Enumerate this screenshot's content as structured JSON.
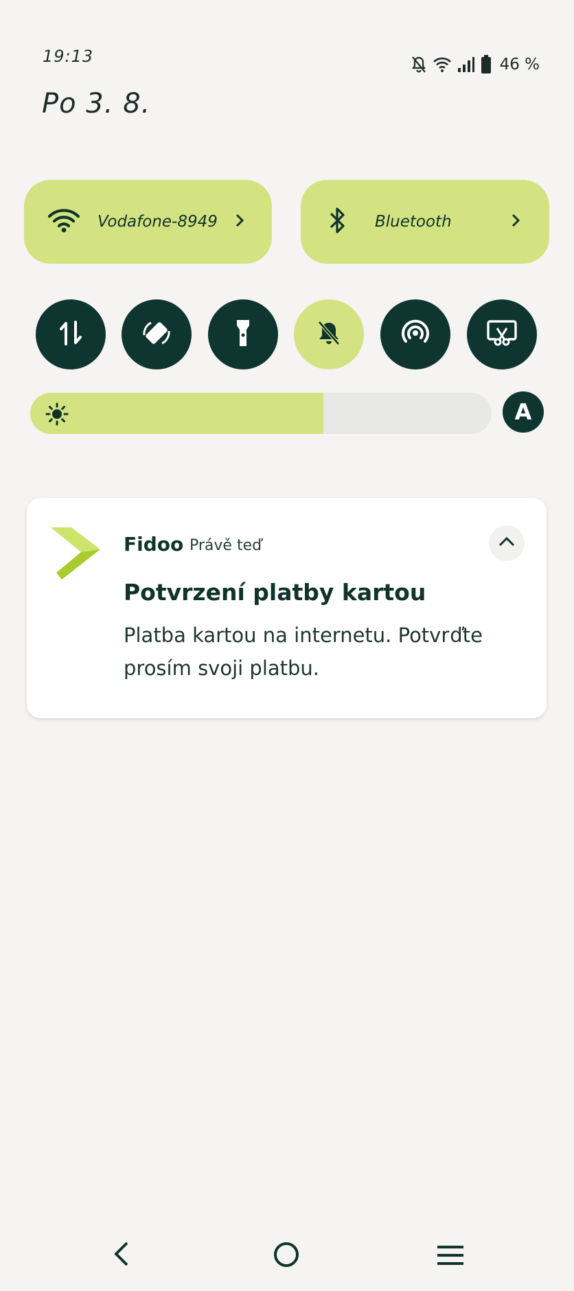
{
  "status_bar": {
    "time": "19:13",
    "battery_percent": "46 %",
    "icons": [
      "bell-off-icon",
      "wifi-icon",
      "signal-icon",
      "battery-icon"
    ]
  },
  "date": "Po 3. 8.",
  "tiles": {
    "wifi": {
      "label": "Vodafone-8949",
      "icon": "wifi-icon"
    },
    "bluetooth": {
      "label": "Bluetooth",
      "icon": "bluetooth-icon"
    }
  },
  "quick_settings": [
    {
      "icon": "mobile-data-icon",
      "active": false
    },
    {
      "icon": "auto-rotate-icon",
      "active": false
    },
    {
      "icon": "flashlight-icon",
      "active": false
    },
    {
      "icon": "do-not-disturb-icon",
      "active": true
    },
    {
      "icon": "hotspot-icon",
      "active": false
    },
    {
      "icon": "screen-cast-icon",
      "active": false
    }
  ],
  "brightness": {
    "level": 0.635,
    "auto_label": "A"
  },
  "notification": {
    "app_name": "Fidoo",
    "time": "Právě teď",
    "title": "Potvrzení platby kartou",
    "body": "Platba kartou na internetu. Potvrďte prosím svoji platbu."
  },
  "colors": {
    "accent": "#d4e381",
    "dark": "#0f3530",
    "background": "#f5f4f2"
  },
  "nav_bar": [
    "back-icon",
    "home-icon",
    "menu-icon"
  ]
}
